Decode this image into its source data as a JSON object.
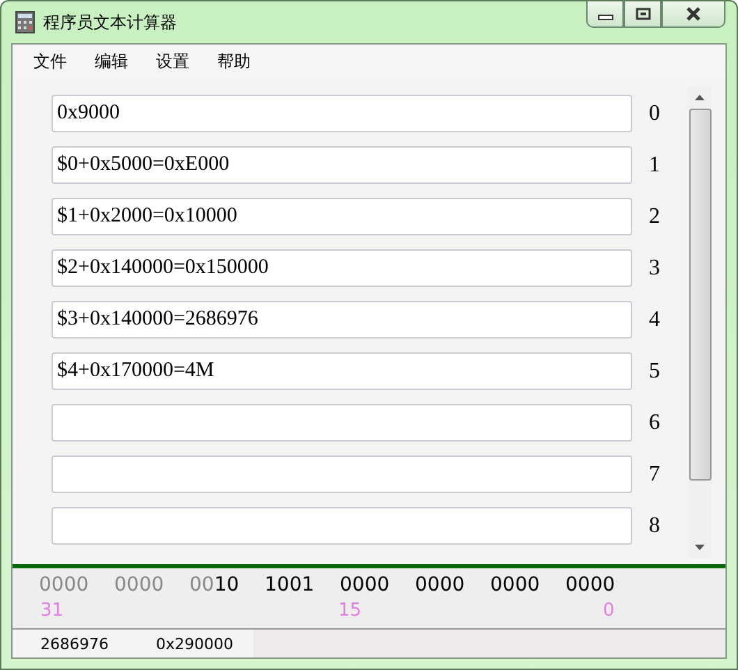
{
  "window": {
    "title": "程序员文本计算器"
  },
  "menu": [
    "文件",
    "编辑",
    "设置",
    "帮助"
  ],
  "rows": [
    {
      "value": "0x9000",
      "index": "0"
    },
    {
      "value": "$0+0x5000=0xE000",
      "index": "1"
    },
    {
      "value": "$1+0x2000=0x10000",
      "index": "2"
    },
    {
      "value": "$2+0x140000=0x150000",
      "index": "3"
    },
    {
      "value": "$3+0x140000=2686976",
      "index": "4"
    },
    {
      "value": "$4+0x170000=4M",
      "index": "5"
    },
    {
      "index": "6"
    },
    {
      "index": "7"
    },
    {
      "index": "8"
    }
  ],
  "bits": [
    {
      "dim": "0000"
    },
    {
      "dim": "0000"
    },
    {
      "dim": "00",
      "lit": "10"
    },
    {
      "lit": "1001"
    },
    {
      "lit": "0000"
    },
    {
      "lit": "0000"
    },
    {
      "lit": "0000"
    },
    {
      "lit": "0000"
    }
  ],
  "bit_labels": [
    "31",
    "15",
    "0"
  ],
  "status_bar": [
    "2686976",
    "0x290000"
  ]
}
